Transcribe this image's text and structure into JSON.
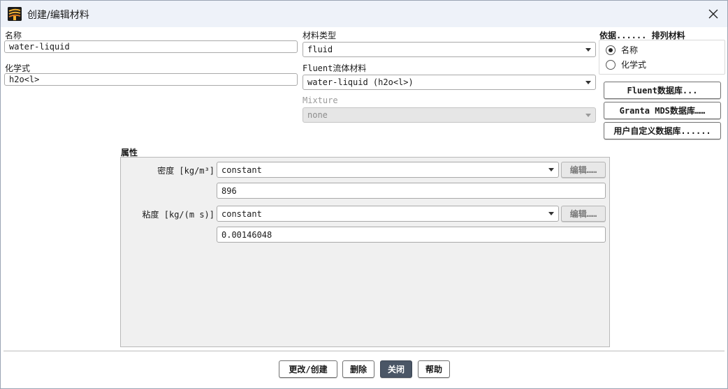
{
  "window": {
    "title": "创建/编辑材料",
    "icon": "fluent-app-icon"
  },
  "name": {
    "label": "名称",
    "value": "water-liquid"
  },
  "formula": {
    "label": "化学式",
    "value": "h2o<l>"
  },
  "material_type": {
    "label": "材料类型",
    "value": "fluid"
  },
  "fluent_material": {
    "label": "Fluent流体材料",
    "value": "water-liquid (h2o<l>)"
  },
  "mixture": {
    "label": "Mixture",
    "value": "none"
  },
  "order_by": {
    "label": "依据...... 排列材料",
    "options": [
      {
        "label": "名称",
        "selected": true
      },
      {
        "label": "化学式",
        "selected": false
      }
    ]
  },
  "databases": {
    "fluent": "Fluent数据库...",
    "granta": "Granta MDS数据库……",
    "user": "用户自定义数据库......"
  },
  "properties": {
    "label": "属性",
    "density": {
      "label": "密度 [kg/m³]",
      "method": "constant",
      "edit": "编辑……",
      "value": "896"
    },
    "viscosity": {
      "label": "粘度 [kg/(m s)]",
      "method": "constant",
      "edit": "编辑……",
      "value": "0.00146048"
    }
  },
  "buttons": {
    "change_create": "更改/创建",
    "delete": "删除",
    "close": "关闭",
    "help": "帮助"
  }
}
